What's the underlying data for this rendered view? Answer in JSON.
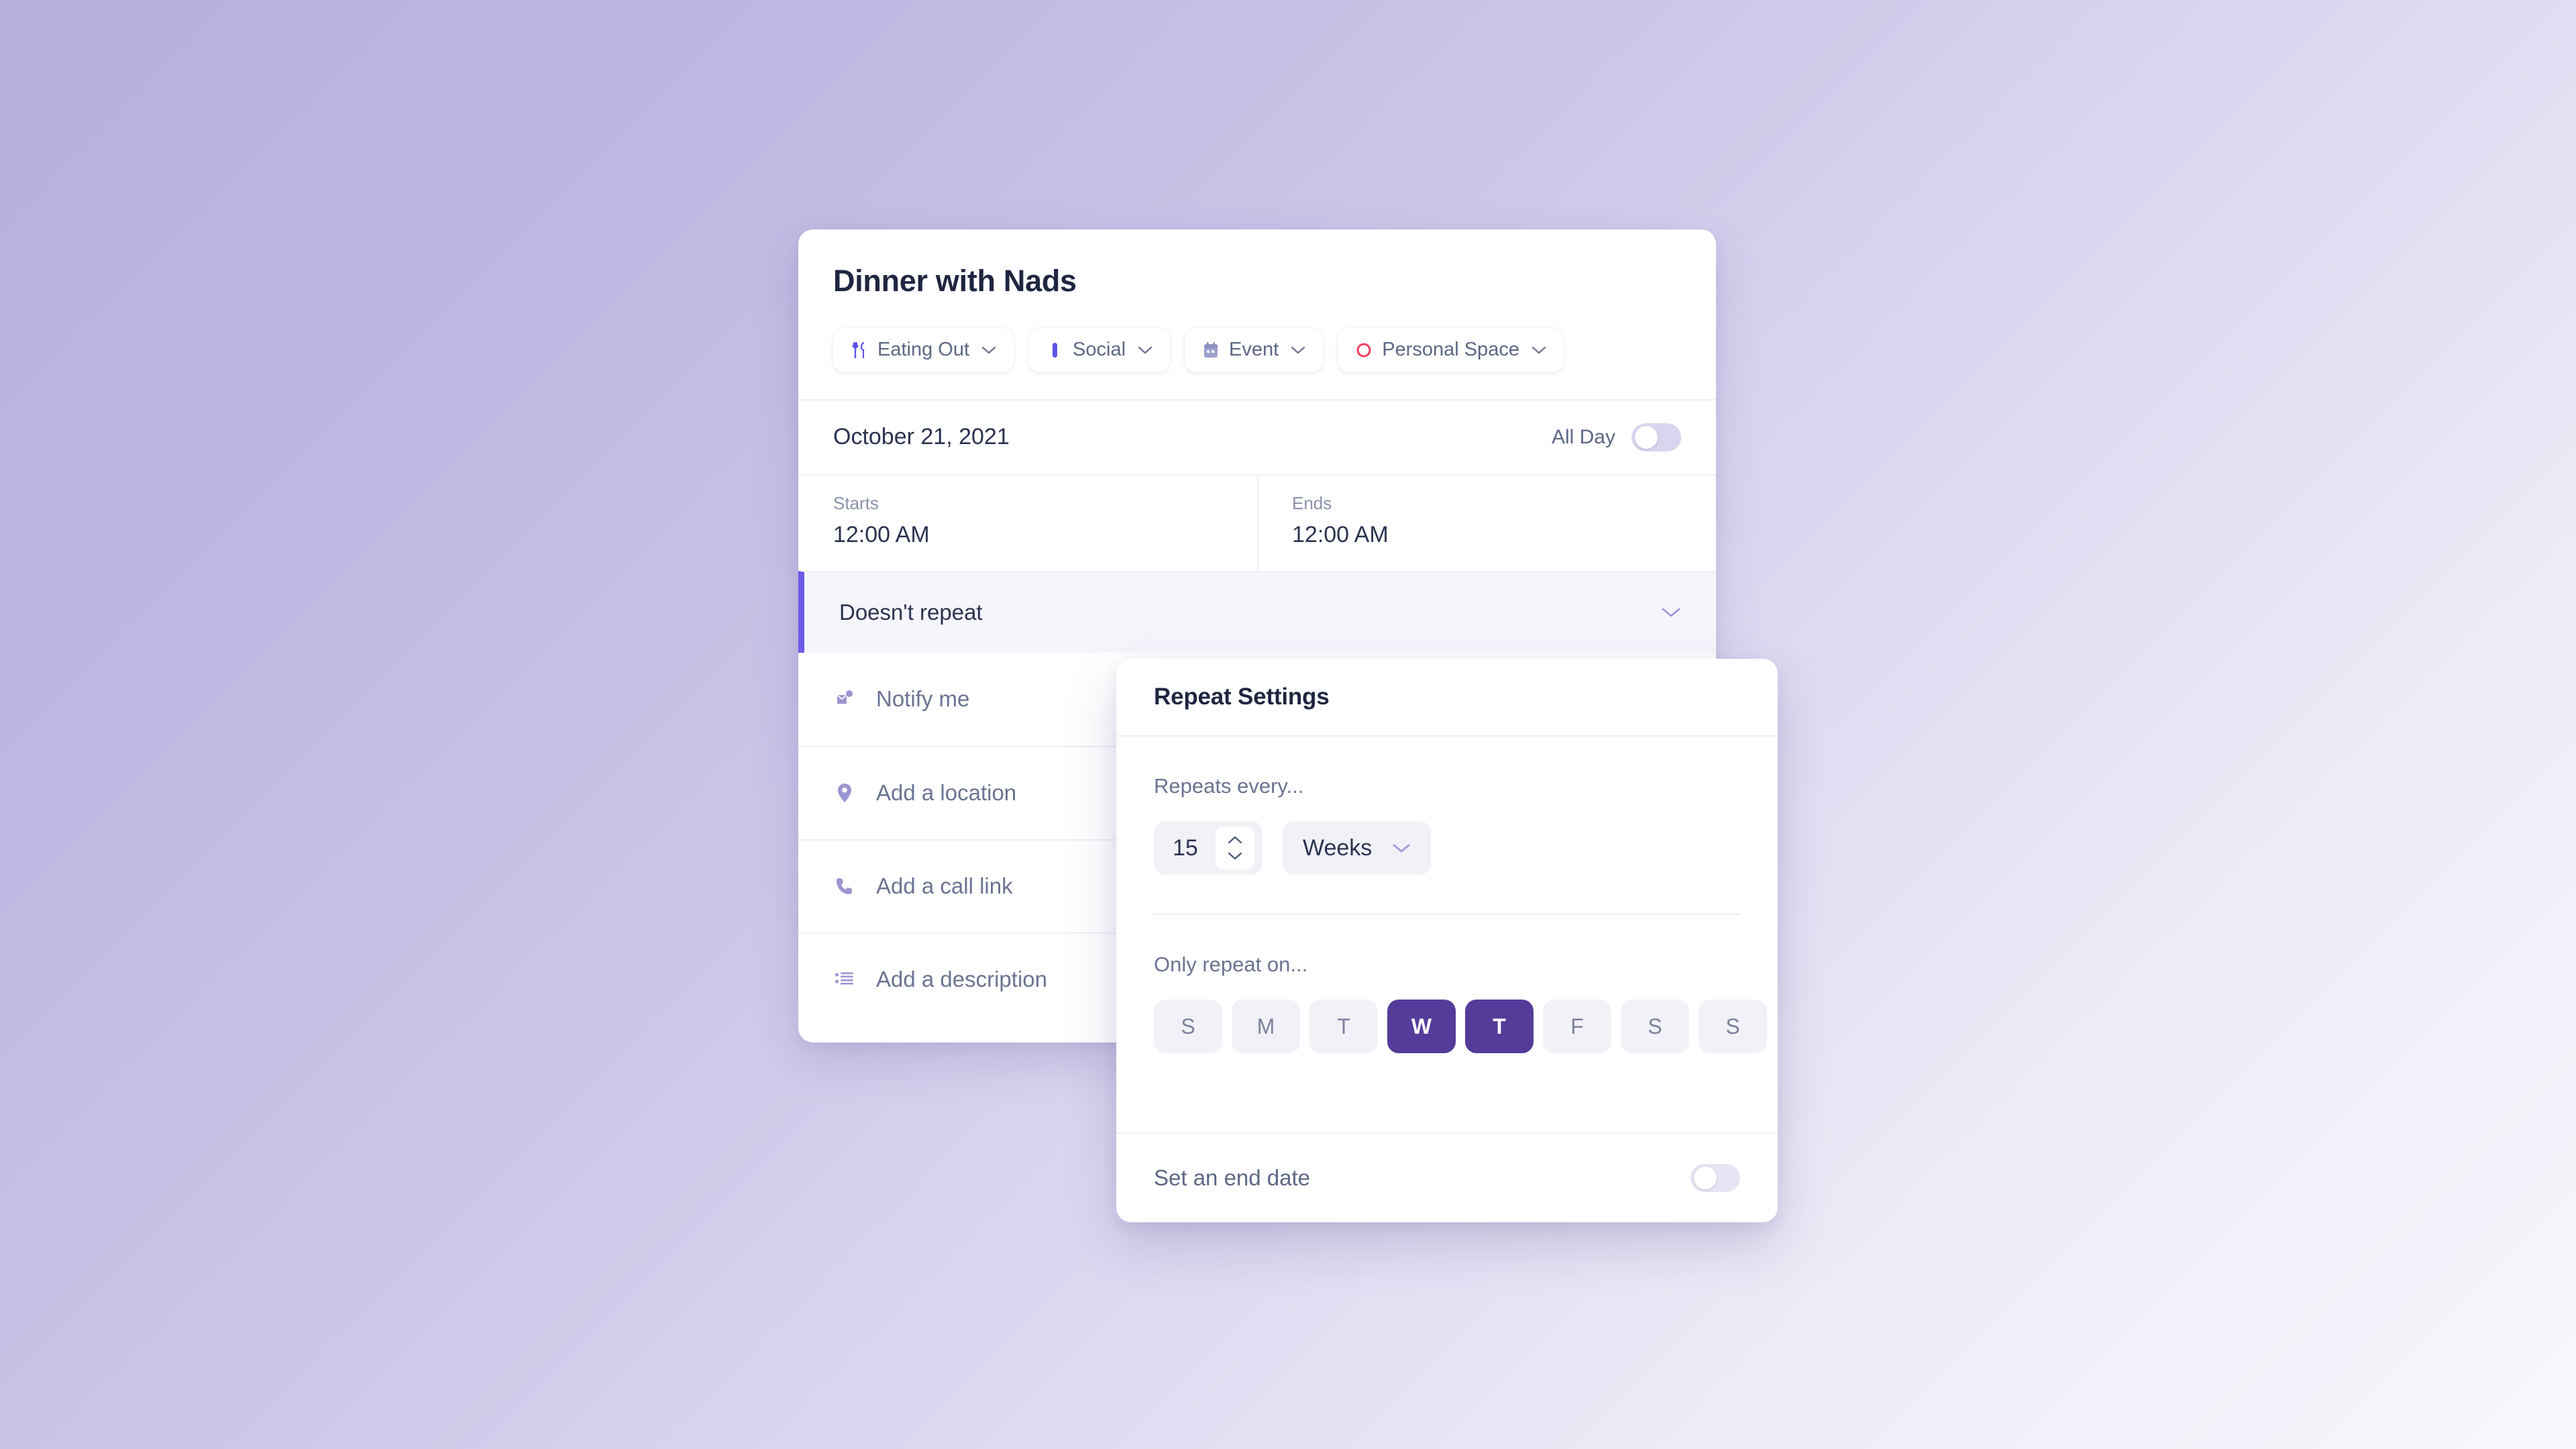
{
  "event": {
    "title": "Dinner with Nads",
    "chips": [
      {
        "label": "Eating Out",
        "icon": "cutlery-icon",
        "color": "#5b54e8"
      },
      {
        "label": "Social",
        "icon": "bookmark-icon",
        "color": "#5b54e8"
      },
      {
        "label": "Event",
        "icon": "calendar-icon",
        "color": "#8b8fc2"
      },
      {
        "label": "Personal Space",
        "icon": "circle-outline-icon",
        "color": "#f43f5e"
      }
    ],
    "date": "October 21, 2021",
    "all_day": {
      "label": "All Day",
      "on": false
    },
    "starts": {
      "caption": "Starts",
      "value": "12:00 AM"
    },
    "ends": {
      "caption": "Ends",
      "value": "12:00 AM"
    },
    "repeat": {
      "label": "Doesn't repeat",
      "expanded": true
    },
    "actions": [
      {
        "label": "Notify me",
        "icon": "bell-notification-icon"
      },
      {
        "label": "Add a location",
        "icon": "location-pin-icon"
      },
      {
        "label": "Add a call link",
        "icon": "phone-icon"
      },
      {
        "label": "Add a description",
        "icon": "list-icon"
      }
    ]
  },
  "repeat_settings": {
    "title": "Repeat Settings",
    "every_label": "Repeats every...",
    "interval_value": "15",
    "unit_value": "Weeks",
    "only_repeat_label": "Only repeat on...",
    "days": [
      {
        "letter": "S",
        "selected": false
      },
      {
        "letter": "M",
        "selected": false
      },
      {
        "letter": "T",
        "selected": false
      },
      {
        "letter": "W",
        "selected": true
      },
      {
        "letter": "T",
        "selected": true
      },
      {
        "letter": "F",
        "selected": false
      },
      {
        "letter": "S",
        "selected": false
      },
      {
        "letter": "S",
        "selected": false
      }
    ],
    "end_date": {
      "label": "Set an end date",
      "on": false
    }
  },
  "theme": {
    "accent": "#6c5ce7",
    "selected_day": "#553c9a",
    "danger": "#f43f5e",
    "bg_start": "#b7aedd",
    "bg_end": "#f8f7fb"
  }
}
